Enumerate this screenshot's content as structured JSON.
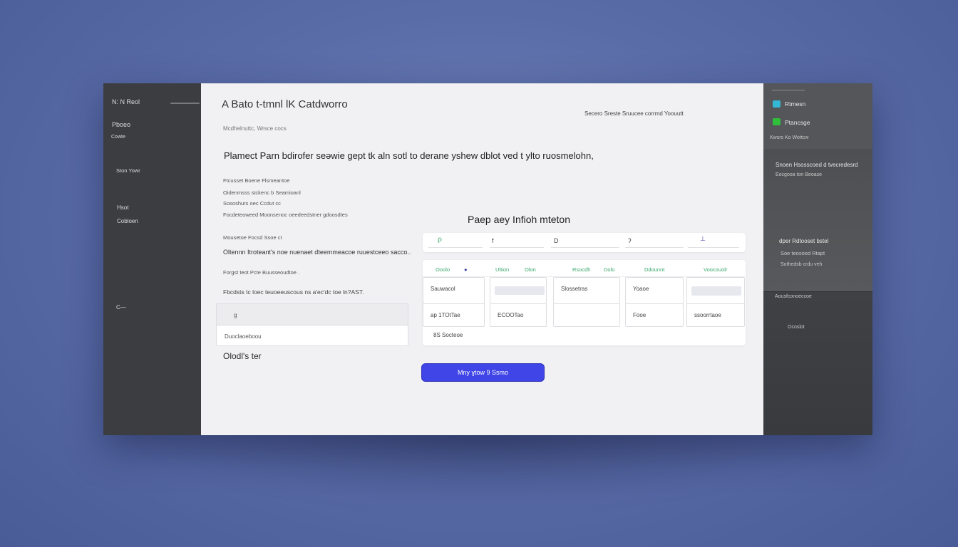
{
  "colors": {
    "accent": "#3f45e6",
    "green": "#3aa76d",
    "orange": "#e29a2b",
    "cyan": "#35b7d6",
    "bright_green": "#2fbf3a"
  },
  "sidebar_left": {
    "items": [
      "N: N Reol",
      "Pboeo",
      "Cowte",
      "Ston Yowr",
      "Hsot",
      "Cobloen",
      "C—"
    ]
  },
  "main": {
    "title": "A  Bato t-tmnl lK  Catdworro",
    "subtitle": "Mcdhelnuttc, Wrsce cocs",
    "top_right": "Secero Sreste Sruucee corrmd Yoouutt",
    "lead": "Plamect Parn bdirofer seǝwie gept tk aln sotl to derane yshew dblot ved t ylto ruosmelohn,",
    "notes": [
      "Ftcusset Boene Flsmeantoe",
      "Oidenmsss stckenc b Seamioanl",
      "Sososhurs oec Ccdut cc",
      "Focdeteoweed Moonsenoc oeedeedstner gdoosdtes",
      "Mousetoe Focsd Ssoe ct",
      "Oltennn Itroteant's noe nuenaet dteemmeacoe ruuestceeo sacco..",
      "Forgst teot Pcte Buusseoudtoe .",
      "Fbcdsts tc loec teuoeeuscous ns a'ec'dc toe ln?AST."
    ],
    "input_a": "g",
    "input_b": "Duoclaoeboou",
    "feedback_label": "Olodl's ter",
    "panel_title": "Paep aey Infioh mteton",
    "filters": [
      "Ṗ",
      "f",
      "D",
      "ʔ",
      "⊥"
    ],
    "table_headers": [
      "Ooolo",
      "●",
      "Ultion",
      "Olon",
      "Rsocdh",
      "Dolo",
      "Ddounnt",
      "Voocouolr"
    ],
    "row1": [
      "Sauwacol",
      "",
      "Slossetras",
      "Yoaoe",
      ""
    ],
    "row2": [
      "ap 1TOtTae",
      "ECOOTao",
      "",
      "Fooe",
      "ssoorrtaoe"
    ],
    "table_footer": "8S  Socteoe",
    "cta_label": "Mny ɣtow 9 Ssmo"
  },
  "sidebar_right": {
    "items": [
      "Rtmesn",
      "Ptancsge",
      "Kwsrs Ko Wottcw",
      "Snoen Hsosscoed d tvecredesrd",
      "Eocgooa ton Beoase",
      "dper Rdtooset bstel",
      "Soe teosood Rtapt",
      "Sothedsb crdu veh",
      "Aousfconoeccoe",
      "Ocoslot"
    ]
  }
}
